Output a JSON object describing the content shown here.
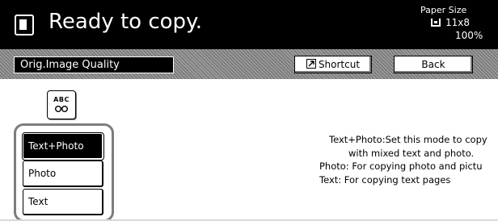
{
  "status": {
    "message": "Ready to copy.",
    "paper_size_label": "Paper Size",
    "paper_size_value": "11x8",
    "zoom": "100%"
  },
  "header": {
    "title": "Orig.Image Quality",
    "shortcut_label": "Shortcut",
    "back_label": "Back"
  },
  "mode_icon": {
    "text": "ABC"
  },
  "options": [
    {
      "label": "Text+Photo",
      "selected": true
    },
    {
      "label": "Photo",
      "selected": false
    },
    {
      "label": "Text",
      "selected": false
    }
  ],
  "help": {
    "line1": "Text+Photo:Set this mode to copy",
    "line2": "with mixed text and photo.",
    "line3": "Photo: For copying photo and pictu",
    "line4": "Text: For copying text pages"
  },
  "colors": {
    "status_bar": "#000000",
    "band": "#8a8a8a",
    "selected_option": "#000000",
    "group_outline": "#7d7d7d"
  },
  "icons": {
    "status": "document-icon",
    "tray": "paper-tray-icon",
    "shortcut": "shortcut-arrow-icon",
    "mode": "text-photo-mode-icon"
  }
}
